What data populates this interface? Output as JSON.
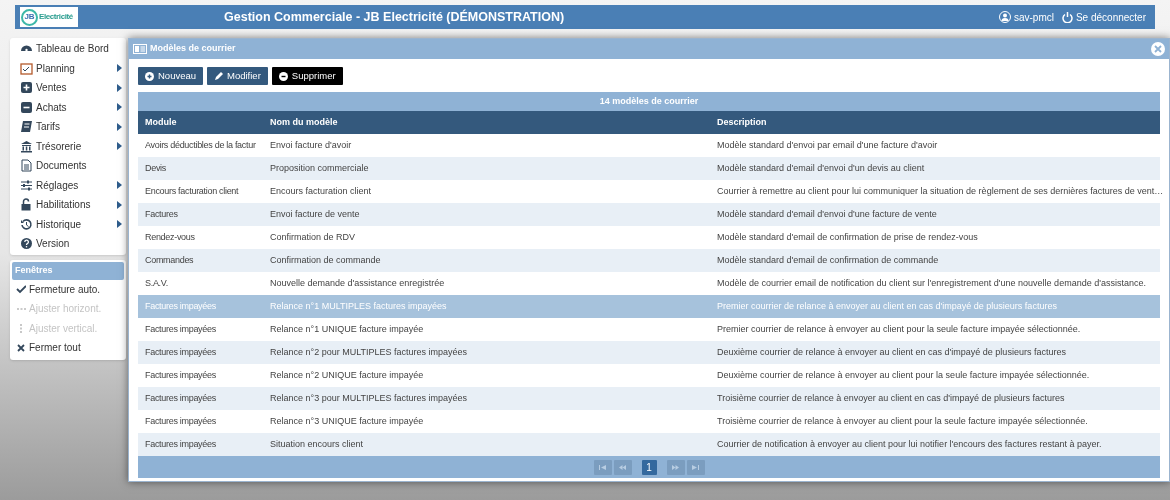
{
  "header": {
    "logo": {
      "mark": "JB",
      "text": "Electricité"
    },
    "title": "Gestion Commerciale - JB Electricité (DÉMONSTRATION)",
    "user": "sav-pmcl",
    "logout": "Se déconnecter"
  },
  "menu": [
    {
      "label": "Tableau de Bord",
      "kind": "dashboard",
      "submenu": false
    },
    {
      "label": "Planning",
      "kind": "calendar",
      "submenu": true
    },
    {
      "label": "Ventes",
      "kind": "plus",
      "submenu": true
    },
    {
      "label": "Achats",
      "kind": "minus",
      "submenu": true
    },
    {
      "label": "Tarifs",
      "kind": "book",
      "submenu": true
    },
    {
      "label": "Trésorerie",
      "kind": "bank",
      "submenu": true
    },
    {
      "label": "Documents",
      "kind": "document",
      "submenu": false
    },
    {
      "label": "Réglages",
      "kind": "sliders",
      "submenu": true
    },
    {
      "label": "Habilitations",
      "kind": "lock",
      "submenu": true
    },
    {
      "label": "Historique",
      "kind": "history",
      "submenu": true
    },
    {
      "label": "Version",
      "kind": "question",
      "submenu": false
    }
  ],
  "windows_panel": {
    "title": "Fenêtres",
    "items": [
      {
        "label": "Fermeture auto.",
        "kind": "check",
        "disabled": false
      },
      {
        "label": "Ajuster horizont.",
        "kind": "dots",
        "disabled": true
      },
      {
        "label": "Ajuster vertical.",
        "kind": "vdots",
        "disabled": true
      },
      {
        "label": "Fermer tout",
        "kind": "x",
        "disabled": false
      }
    ]
  },
  "dialog": {
    "title": "Modèles de courrier",
    "buttons": [
      {
        "label": "Nouveau",
        "kind": "add"
      },
      {
        "label": "Modifier",
        "kind": "edit"
      },
      {
        "label": "Supprimer",
        "kind": "delete"
      }
    ],
    "table": {
      "caption": "14 modèles de courrier",
      "columns": [
        "Module",
        "Nom du modèle",
        "Description"
      ],
      "rows": [
        {
          "cells": [
            "Avoirs déductibles de la factur",
            "Envoi facture d'avoir",
            "Modèle standard d'envoi par email d'une facture d'avoir"
          ],
          "selected": false
        },
        {
          "cells": [
            "Devis",
            "Proposition commerciale",
            "Modèle standard d'email d'envoi d'un devis au client"
          ],
          "selected": false
        },
        {
          "cells": [
            "Encours facturation client",
            "Encours facturation client",
            "Courrier à remettre au client pour lui communiquer la situation de règlement de ses dernières factures de vent…"
          ],
          "selected": false
        },
        {
          "cells": [
            "Factures",
            "Envoi facture de vente",
            "Modèle standard d'email d'envoi d'une facture de vente"
          ],
          "selected": false
        },
        {
          "cells": [
            "Rendez-vous",
            "Confirmation de RDV",
            "Modèle standard d'email de confirmation de prise de rendez-vous"
          ],
          "selected": false
        },
        {
          "cells": [
            "Commandes",
            "Confirmation de commande",
            "Modèle standard d'email de confirmation de commande"
          ],
          "selected": false
        },
        {
          "cells": [
            "S.A.V.",
            "Nouvelle demande d'assistance enregistrée",
            "Modèle de courrier email de notification du client sur l'enregistrement d'une nouvelle demande d'assistance."
          ],
          "selected": false
        },
        {
          "cells": [
            "Factures impayées",
            "Relance n°1 MULTIPLES factures impayées",
            "Premier courrier de relance à envoyer au client en cas d'impayé de plusieurs factures"
          ],
          "selected": true
        },
        {
          "cells": [
            "Factures impayées",
            "Relance n°1 UNIQUE facture impayée",
            "Premier courrier de relance à envoyer au client pour la seule facture impayée sélectionnée."
          ],
          "selected": false
        },
        {
          "cells": [
            "Factures impayées",
            "Relance n°2 pour MULTIPLES factures impayées",
            "Deuxième courrier de relance à envoyer au client en cas d'impayé de plusieurs factures"
          ],
          "selected": false
        },
        {
          "cells": [
            "Factures impayées",
            "Relance n°2 UNIQUE facture impayée",
            "Deuxième courrier de relance à envoyer au client pour la seule facture impayée sélectionnée."
          ],
          "selected": false
        },
        {
          "cells": [
            "Factures impayées",
            "Relance n°3 pour MULTIPLES factures impayées",
            "Troisième courrier de relance à envoyer au client en cas d'impayé de plusieurs factures"
          ],
          "selected": false
        },
        {
          "cells": [
            "Factures impayées",
            "Relance n°3 UNIQUE facture impayée",
            "Troisième courrier de relance à envoyer au client pour la seule facture impayée sélectionnée."
          ],
          "selected": false
        },
        {
          "cells": [
            "Factures impayées",
            "Situation encours client",
            "Courrier de notification à envoyer au client pour lui notifier l'encours des factures restant à payer."
          ],
          "selected": false
        }
      ]
    },
    "pager": {
      "pages": [
        {
          "label": "1",
          "selected": true
        }
      ]
    }
  }
}
